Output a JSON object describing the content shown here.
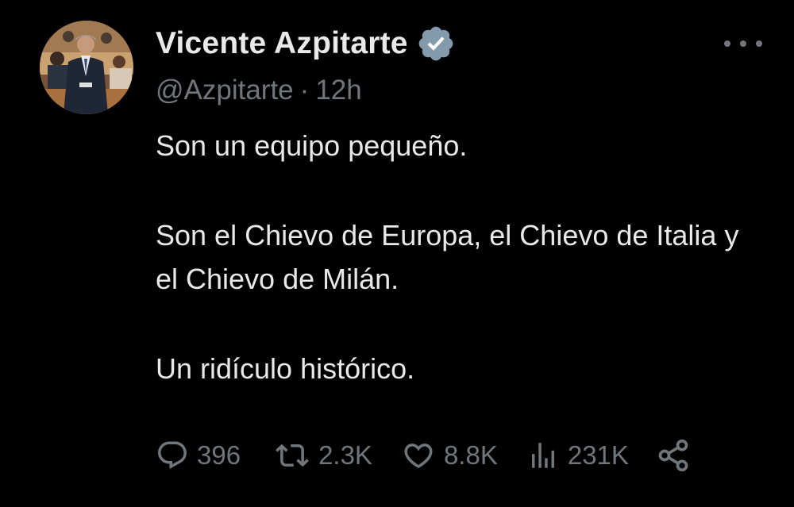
{
  "author": {
    "display_name": "Vicente Azpitarte",
    "handle": "@Azpitarte",
    "separator": "·",
    "time": "12h",
    "verified": true,
    "avatar_icon": "profile-photo"
  },
  "menu": {
    "icon": "more-horizontal-icon"
  },
  "tweet": {
    "paragraph_1": "Son un equipo pequeño.",
    "paragraph_2": "Son el Chievo de Europa, el Chievo de Italia y el Chievo de Milán.",
    "paragraph_3": "Un ridículo histórico."
  },
  "actions": {
    "replies": "396",
    "retweets": "2.3K",
    "likes": "8.8K",
    "views": "231K",
    "share_icon": "share-icon"
  },
  "colors": {
    "background": "#000000",
    "text_primary": "#e7e9ea",
    "text_secondary": "#71767b",
    "verified_badge": "#829aab"
  }
}
